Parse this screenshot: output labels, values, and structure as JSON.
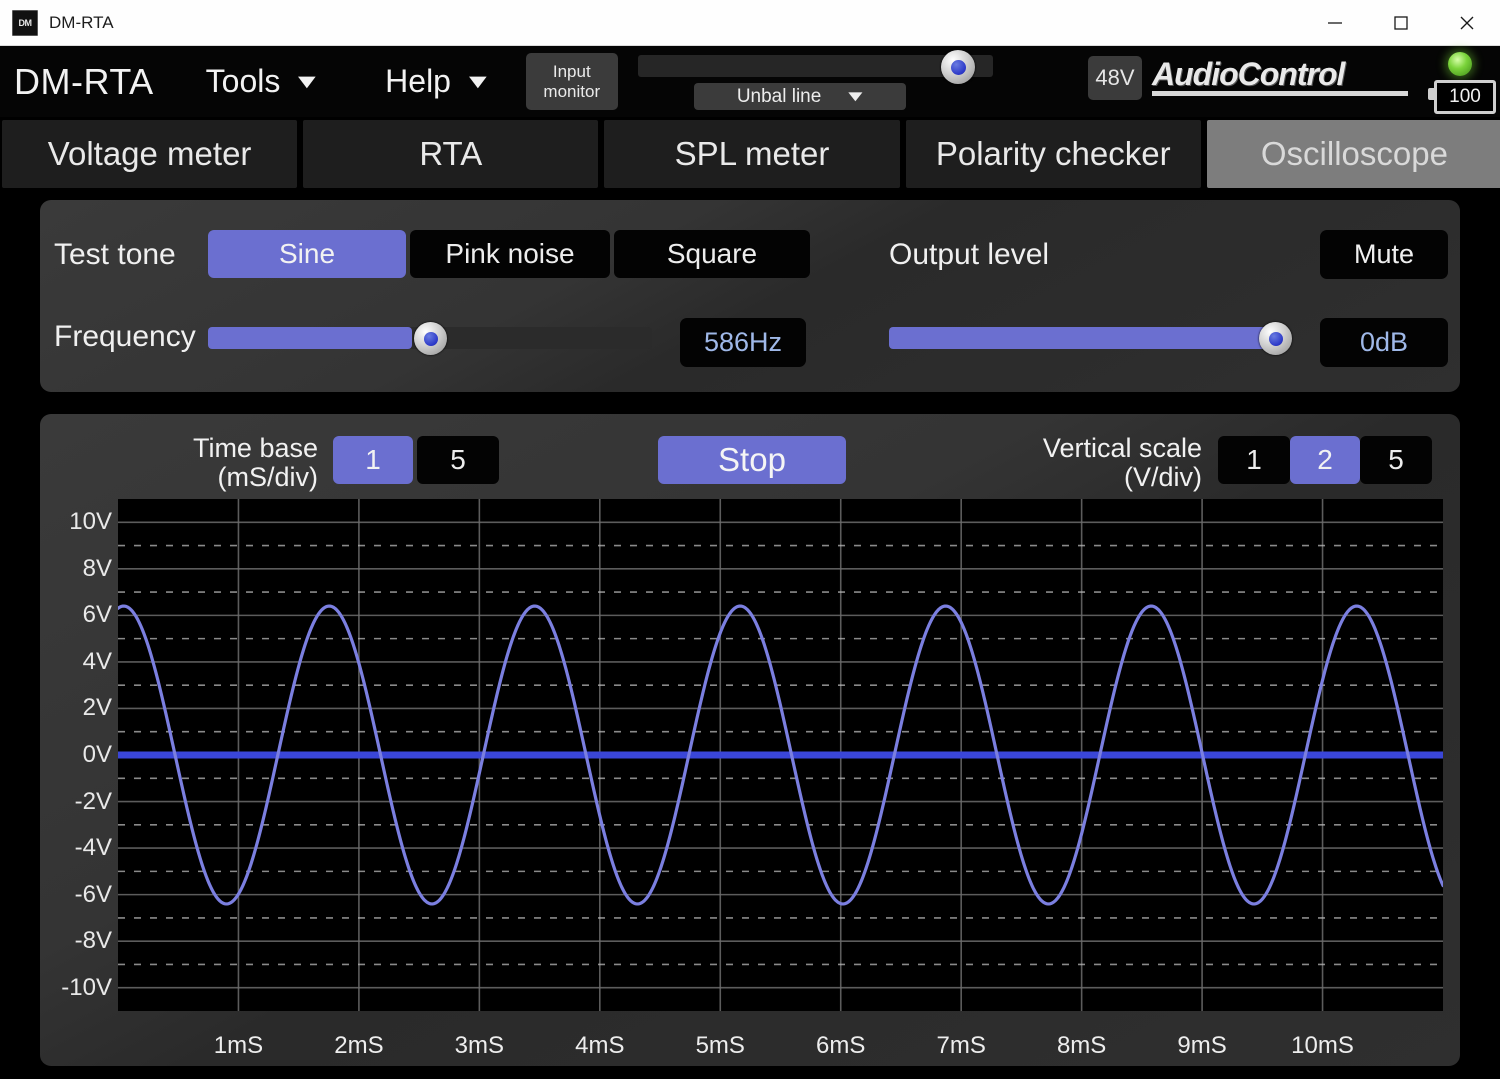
{
  "window": {
    "title": "DM-RTA",
    "icon_label": "DM",
    "minimize": "–",
    "maximize": "□",
    "close": "✕"
  },
  "topbar": {
    "brand": "DM-RTA",
    "tools": "Tools",
    "help": "Help",
    "caret": "▼",
    "input_monitor_line1": "Input",
    "input_monitor_line2": "monitor",
    "input_source": "Unbal line",
    "phantom": "48V",
    "logo": "AudioControl",
    "battery": "100"
  },
  "tabs": [
    {
      "label": "Voltage meter",
      "active": false
    },
    {
      "label": "RTA",
      "active": false
    },
    {
      "label": "SPL meter",
      "active": false
    },
    {
      "label": "Polarity checker",
      "active": false
    },
    {
      "label": "Oscilloscope",
      "active": true
    }
  ],
  "test_tone": {
    "label": "Test tone",
    "options": [
      "Sine",
      "Pink noise",
      "Square"
    ],
    "selected": "Sine",
    "frequency_label": "Frequency",
    "frequency_value": "586Hz",
    "frequency_pct": 46
  },
  "output": {
    "label": "Output level",
    "mute_label": "Mute",
    "level_value": "0dB",
    "level_pct": 100
  },
  "scope_controls": {
    "time_base_label_1": "Time base",
    "time_base_label_2": "(mS/div)",
    "time_base_options": [
      "1",
      "5"
    ],
    "time_base_selected": "1",
    "run_button": "Stop",
    "vertical_scale_label_1": "Vertical scale",
    "vertical_scale_label_2": "(V/div)",
    "vertical_scale_options": [
      "1",
      "2",
      "5"
    ],
    "vertical_scale_selected": "2"
  },
  "colors": {
    "accent": "#6b6fd0",
    "trace": "#7b7fe0",
    "zero_line": "#3a46d8",
    "readout_text": "#9fb8e8",
    "led": "#7ad33a",
    "panel": "#343434",
    "tab_active": "#7d7d7d"
  },
  "chart_data": {
    "type": "line",
    "title": "Oscilloscope",
    "xlabel": "mS",
    "ylabel": "V",
    "xlim": [
      0,
      11
    ],
    "ylim": [
      -11,
      11
    ],
    "grid": true,
    "x_ticks": [
      "1mS",
      "2mS",
      "3mS",
      "4mS",
      "5mS",
      "6mS",
      "7mS",
      "8mS",
      "9mS",
      "10mS"
    ],
    "x_tick_values": [
      1,
      2,
      3,
      4,
      5,
      6,
      7,
      8,
      9,
      10
    ],
    "y_ticks": [
      "10V",
      "8V",
      "6V",
      "4V",
      "2V",
      "0V",
      "-2V",
      "-4V",
      "-6V",
      "-8V",
      "-10V"
    ],
    "y_tick_values": [
      10,
      8,
      6,
      4,
      2,
      0,
      -2,
      -4,
      -6,
      -8,
      -10
    ],
    "series": [
      {
        "name": "Zero reference",
        "type": "horizontal-line",
        "value": 0,
        "color": "#3a46d8"
      },
      {
        "name": "Sine 586Hz",
        "color": "#7b7fe0",
        "waveform": "sine",
        "amplitude_v": 6.4,
        "frequency_hz": 586,
        "period_ms": 1.706,
        "phase_deg": 80,
        "offset_v": 0,
        "cycles_visible": 6.4
      }
    ]
  }
}
